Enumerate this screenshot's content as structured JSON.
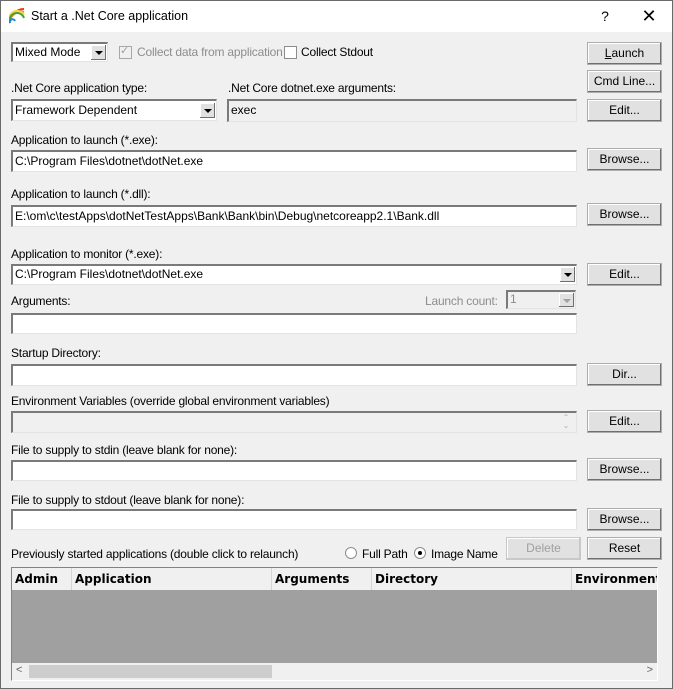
{
  "window": {
    "title": "Start a .Net Core application",
    "help_label": "?",
    "close_label": "✕"
  },
  "top": {
    "mode_select": "Mixed Mode",
    "collect_data_label": "Collect data from application",
    "collect_data_checked": true,
    "collect_data_enabled": false,
    "collect_stdout_label": "Collect Stdout",
    "collect_stdout_checked": false
  },
  "buttons": {
    "launch": "Launch",
    "cmd_line": "Cmd Line...",
    "edit_args": "Edit...",
    "browse_exe": "Browse...",
    "browse_dll": "Browse...",
    "edit_monitor": "Edit...",
    "dir": "Dir...",
    "edit_env": "Edit...",
    "browse_stdin": "Browse...",
    "browse_stdout": "Browse...",
    "delete": "Delete",
    "reset": "Reset"
  },
  "fields": {
    "app_type_label": ".Net Core application type:",
    "app_type_value": "Framework Dependent",
    "dotnet_args_label": ".Net Core dotnet.exe arguments:",
    "dotnet_args_value": "exec",
    "launch_exe_label": "Application to launch (*.exe):",
    "launch_exe_value": "C:\\Program Files\\dotnet\\dotNet.exe",
    "launch_dll_label": "Application to launch (*.dll):",
    "launch_dll_value": "E:\\om\\c\\testApps\\dotNetTestApps\\Bank\\Bank\\bin\\Debug\\netcoreapp2.1\\Bank.dll",
    "monitor_label": "Application to monitor (*.exe):",
    "monitor_value": "C:\\Program Files\\dotnet\\dotNet.exe",
    "arguments_label": "Arguments:",
    "arguments_value": "",
    "launch_count_label": "Launch count:",
    "launch_count_value": "1",
    "startup_dir_label": "Startup Directory:",
    "startup_dir_value": "",
    "env_vars_label": "Environment Variables (override global environment variables)",
    "env_vars_value": "",
    "stdin_label": "File to supply to stdin (leave blank for none):",
    "stdin_value": "",
    "stdout_label": "File to supply to stdout (leave blank for none):",
    "stdout_value": ""
  },
  "history": {
    "label": "Previously started applications (double click to relaunch)",
    "radio_full_path": "Full Path",
    "radio_image_name": "Image Name",
    "selected_radio": "Image Name",
    "columns": [
      "Admin",
      "Application",
      "Arguments",
      "Directory",
      "Environment"
    ],
    "rows": []
  }
}
